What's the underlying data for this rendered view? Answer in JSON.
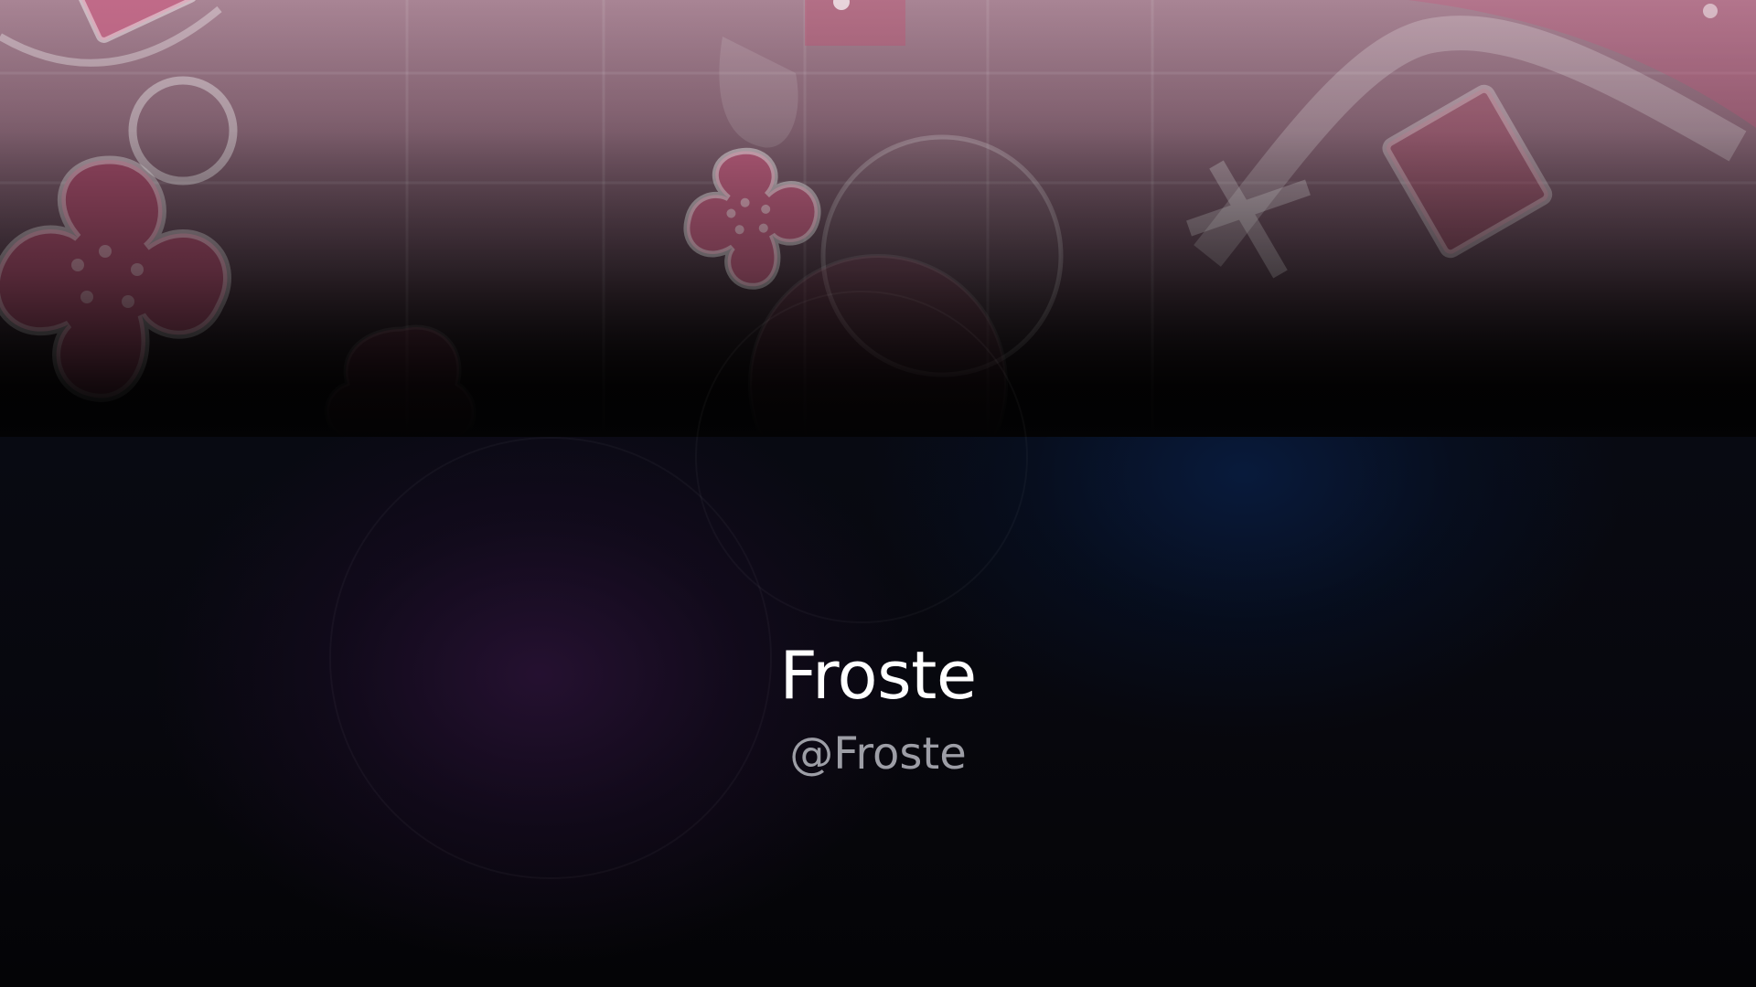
{
  "profile": {
    "display_name": "Froste",
    "handle": "@Froste"
  },
  "banner": {
    "pattern": "pink-sakura-pattern",
    "accent_color": "#c4718d"
  },
  "colors": {
    "background": "#050508",
    "name_text": "#ffffff",
    "handle_text": "#9d9ea6",
    "glow_purple": "#2a1236",
    "glow_blue": "#081c40"
  }
}
